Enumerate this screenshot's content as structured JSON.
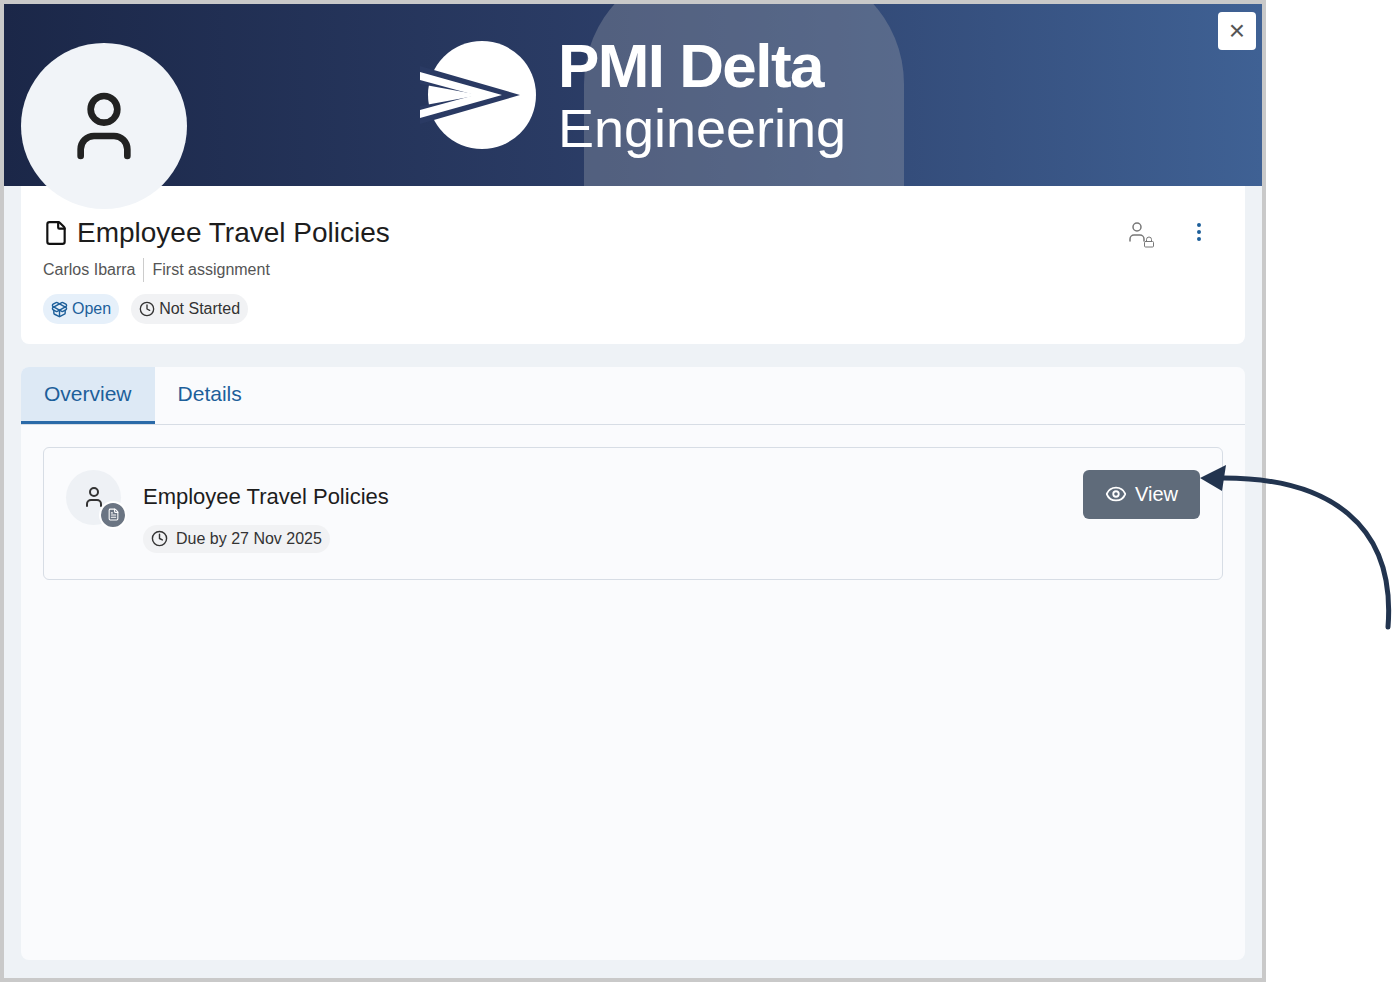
{
  "banner": {
    "logo_top": "PMI Delta",
    "logo_bottom": "Engineering"
  },
  "close_button": "×",
  "header": {
    "title": "Employee Travel Policies",
    "owner": "Carlos Ibarra",
    "assignment": "First assignment",
    "badges": [
      {
        "label": "Open",
        "kind": "status"
      },
      {
        "label": "Not Started",
        "kind": "progress"
      }
    ]
  },
  "tabs": [
    {
      "label": "Overview",
      "selected": true
    },
    {
      "label": "Details",
      "selected": false
    }
  ],
  "items": [
    {
      "title": "Employee Travel Policies",
      "due": "Due by 27 Nov 2025",
      "button": "View"
    }
  ]
}
